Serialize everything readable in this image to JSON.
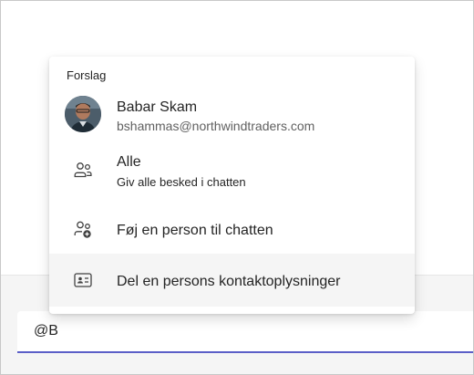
{
  "compose": {
    "value": "@B"
  },
  "suggestions": {
    "header": "Forslag",
    "person": {
      "name": "Babar Skam",
      "email": "bshammas@northwindtraders.com"
    },
    "everyone": {
      "label": "Alle",
      "sublabel": "Giv alle besked i chatten"
    },
    "add_person": {
      "label": "Føj en person til chatten"
    },
    "share_contact": {
      "label": "Del en persons kontaktoplysninger"
    }
  },
  "colors": {
    "accent": "#5b5fc7",
    "hover": "#f5f5f5"
  },
  "icons": {
    "everyone": "people-icon",
    "add_person": "person-add-icon",
    "share_contact": "contact-card-icon"
  }
}
